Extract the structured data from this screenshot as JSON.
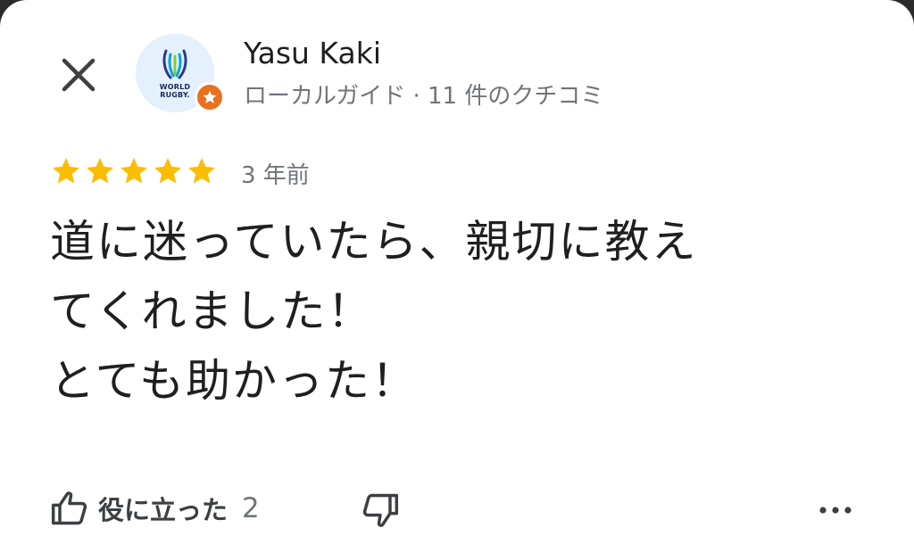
{
  "header": {
    "close_icon": "close-icon"
  },
  "reviewer": {
    "name": "Yasu Kaki",
    "meta": "ローカルガイド · 11 件のクチコミ",
    "avatar_logo_text": [
      "WORLD",
      "RUGBY."
    ],
    "badge_icon": "star-icon",
    "badge_color": "#e8711f"
  },
  "review": {
    "rating": 5,
    "max_rating": 5,
    "star_color": "#fbbc04",
    "time_ago": "3 年前",
    "text_lines": [
      "道に迷っていたら、親切に教え",
      "てくれました！",
      "とても助かった！"
    ]
  },
  "actions": {
    "helpful_label": "役に立った",
    "helpful_count": "2",
    "like_icon": "thumbs-up-icon",
    "dislike_icon": "thumbs-down-icon",
    "more_icon": "more-horizontal-icon"
  }
}
